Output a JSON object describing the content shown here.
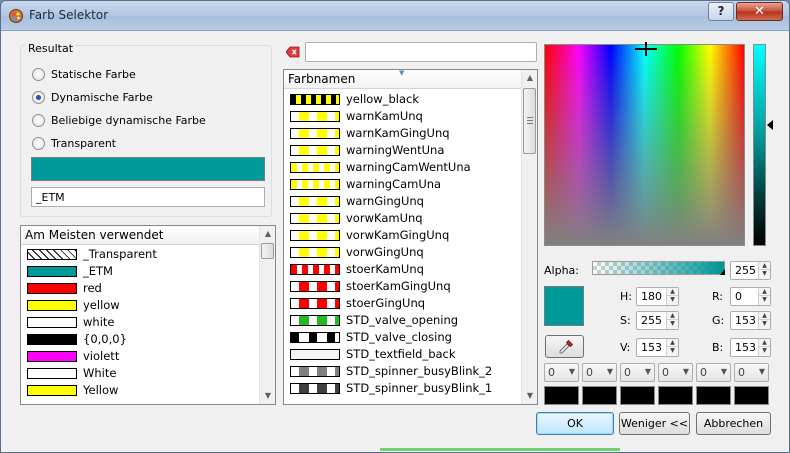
{
  "window": {
    "title": "Farb Selektor",
    "help_label": "?",
    "close_label": "✕"
  },
  "result": {
    "group_label": "Resultat",
    "options": [
      {
        "label": "Statische Farbe",
        "checked": false
      },
      {
        "label": "Dynamische Farbe",
        "checked": true
      },
      {
        "label": "Beliebige dynamische Farbe",
        "checked": false
      },
      {
        "label": "Transparent",
        "checked": false
      }
    ],
    "color": "#009999",
    "name": "_ETM"
  },
  "most_used": {
    "header": "Am Meisten verwendet",
    "items": [
      {
        "label": "_Transparent",
        "pattern": "transparent"
      },
      {
        "label": "_ETM",
        "pattern": "solid",
        "c1": "#009999"
      },
      {
        "label": "red",
        "pattern": "solid",
        "c1": "#ff0000"
      },
      {
        "label": "yellow",
        "pattern": "solid",
        "c1": "#ffff00"
      },
      {
        "label": "white",
        "pattern": "solid",
        "c1": "#ffffff"
      },
      {
        "label": "{0,0,0}",
        "pattern": "solid",
        "c1": "#000000"
      },
      {
        "label": "violett",
        "pattern": "solid",
        "c1": "#ff00ff"
      },
      {
        "label": "White",
        "pattern": "solid",
        "c1": "#ffffff"
      },
      {
        "label": "Yellow",
        "pattern": "solid",
        "c1": "#ffff00"
      }
    ]
  },
  "color_names": {
    "search_value": "",
    "header": "Farbnamen",
    "items": [
      {
        "label": "yellow_black",
        "pattern": "checker",
        "c1": "#ffff00",
        "c2": "#000000"
      },
      {
        "label": "warnKamUnq",
        "pattern": "dashed",
        "c1": "#ffff00",
        "c2": "#ffffff"
      },
      {
        "label": "warnKamGingUnq",
        "pattern": "dashed",
        "c1": "#ffff00",
        "c2": "#ffffff"
      },
      {
        "label": "warningWentUna",
        "pattern": "dashed",
        "c1": "#ffff00",
        "c2": "#ffffff"
      },
      {
        "label": "warningCamWentUna",
        "pattern": "dots",
        "c1": "#ffff00",
        "c2": "#ffffff"
      },
      {
        "label": "warningCamUna",
        "pattern": "dots",
        "c1": "#ffff00",
        "c2": "#ffffff"
      },
      {
        "label": "warnGingUnq",
        "pattern": "dashed",
        "c1": "#ffff00",
        "c2": "#ffffff"
      },
      {
        "label": "vorwKamUnq",
        "pattern": "dashed",
        "c1": "#ffff00",
        "c2": "#ffffff"
      },
      {
        "label": "vorwKamGingUnq",
        "pattern": "dashed",
        "c1": "#ffff00",
        "c2": "#ffffff"
      },
      {
        "label": "vorwGingUnq",
        "pattern": "dashed",
        "c1": "#ffff00",
        "c2": "#ffffff"
      },
      {
        "label": "stoerKamUnq",
        "pattern": "dots",
        "c1": "#ff0000",
        "c2": "#ffffff"
      },
      {
        "label": "stoerKamGingUnq",
        "pattern": "dashed",
        "c1": "#ff0000",
        "c2": "#ffffff"
      },
      {
        "label": "stoerGingUnq",
        "pattern": "dashed",
        "c1": "#ff0000",
        "c2": "#ffffff"
      },
      {
        "label": "STD_valve_opening",
        "pattern": "dashed",
        "c1": "#22bb22",
        "c2": "#ffffff"
      },
      {
        "label": "STD_valve_closing",
        "pattern": "dashed",
        "c1": "#ffffff",
        "c2": "#000000"
      },
      {
        "label": "STD_textfield_back",
        "pattern": "solid",
        "c1": "#f4f4f4"
      },
      {
        "label": "STD_spinner_busyBlink_2",
        "pattern": "dashed",
        "c1": "#808080",
        "c2": "#ffffff"
      },
      {
        "label": "STD_spinner_busyBlink_1",
        "pattern": "dashed",
        "c1": "#404040",
        "c2": "#ffffff"
      }
    ]
  },
  "editor": {
    "alpha_label": "Alpha:",
    "alpha_value": "255",
    "alpha_fraction": 0.97,
    "h_label": "H:",
    "h_value": "180",
    "s_label": "S:",
    "s_value": "255",
    "v_label": "V:",
    "v_value": "153",
    "r_label": "R:",
    "r_value": "0",
    "g_label": "G:",
    "g_value": "153",
    "b_label": "B:",
    "b_value": "153",
    "custom_values": [
      "0",
      "0",
      "0",
      "0",
      "0",
      "0"
    ]
  },
  "buttons": {
    "ok": "OK",
    "less": "Weniger <<",
    "cancel": "Abbrechen"
  }
}
